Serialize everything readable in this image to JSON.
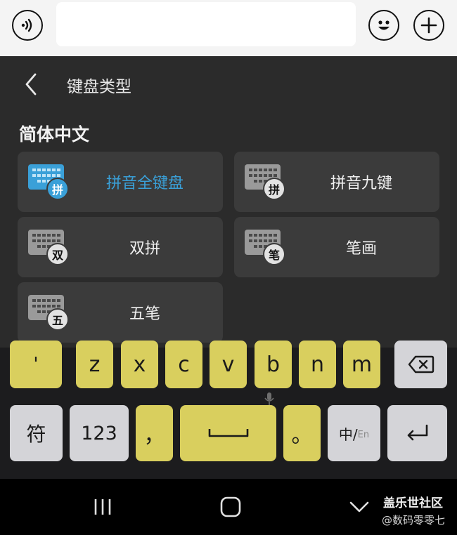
{
  "topbar": {
    "voice_icon": "voice-wave-icon",
    "emoji_icon": "smiley-icon",
    "plus_icon": "plus-icon",
    "message_value": ""
  },
  "panel": {
    "title": "键盘类型",
    "section_title": "简体中文",
    "options": [
      {
        "label": "拼音全键盘",
        "badge": "拼",
        "selected": true
      },
      {
        "label": "拼音九键",
        "badge": "拼",
        "selected": false
      },
      {
        "label": "双拼",
        "badge": "双",
        "selected": false
      },
      {
        "label": "笔画",
        "badge": "笔",
        "selected": false
      },
      {
        "label": "五笔",
        "badge": "五",
        "selected": false
      }
    ],
    "accent_color": "#3aa0d8"
  },
  "keyboard": {
    "row3": [
      "'",
      "z",
      "x",
      "c",
      "v",
      "b",
      "n",
      "m"
    ],
    "symbols_key": "符",
    "number_key": "123",
    "comma_key": "，",
    "period_key": "。",
    "lang_key_main": "中/",
    "lang_key_sub": "En",
    "key_color": "#d9cf5e"
  },
  "nav": {
    "watermark_line1": "盖乐世社区",
    "watermark_line2": "@数码零零七"
  }
}
